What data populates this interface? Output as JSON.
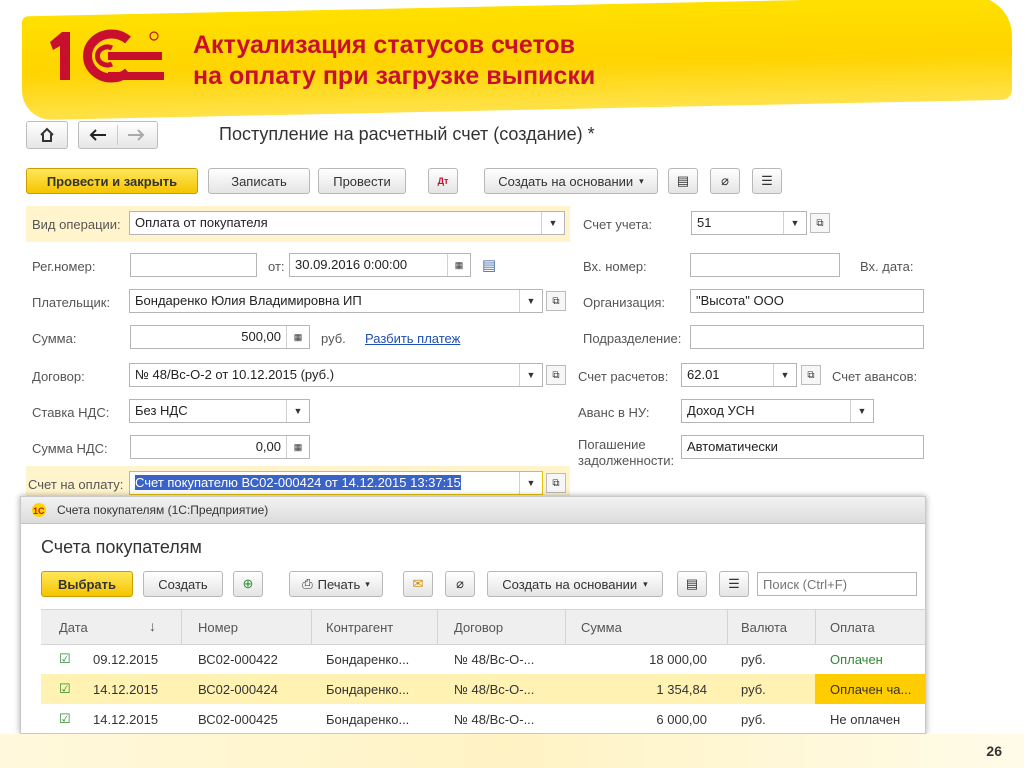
{
  "slide": {
    "title_line1": "Актуализация статусов счетов",
    "title_line2": "на оплату при загрузке выписки",
    "page_number": "26",
    "logo_text": "1С"
  },
  "form": {
    "title": "Поступление на расчетный счет (создание) *",
    "toolbar": {
      "post_close": "Провести и закрыть",
      "save": "Записать",
      "post": "Провести",
      "create_based": "Создать на основании"
    },
    "fields": {
      "op_type_label": "Вид операции:",
      "op_type_value": "Оплата от покупателя",
      "account_label": "Счет учета:",
      "account_value": "51",
      "regnum_label": "Рег.номер:",
      "regnum_value": "",
      "from_label": "от:",
      "date_value": "30.09.2016  0:00:00",
      "in_num_label": "Вх. номер:",
      "in_date_label": "Вх. дата:",
      "payer_label": "Плательщик:",
      "payer_value": "Бондаренко Юлия Владимировна ИП",
      "org_label": "Организация:",
      "org_value": "\"Высота\" ООО",
      "sum_label": "Сумма:",
      "sum_value": "500,00",
      "currency": "руб.",
      "split_link": "Разбить платеж",
      "subdiv_label": "Подразделение:",
      "contract_label": "Договор:",
      "contract_value": "№ 48/Вс-О-2 от 10.12.2015 (руб.)",
      "settle_label": "Счет расчетов:",
      "settle_value": "62.01",
      "advance_label": "Счет авансов:",
      "vat_rate_label": "Ставка НДС:",
      "vat_rate_value": "Без НДС",
      "advance_nu_label": "Аванс в НУ:",
      "advance_nu_value": "Доход УСН",
      "vat_sum_label": "Сумма НДС:",
      "vat_sum_value": "0,00",
      "debt_label_1": "Погашение",
      "debt_label_2": "задолженности:",
      "debt_value": "Автоматически",
      "invoice_label": "Счет на оплату:",
      "invoice_value": "Счет покупателю ВС02-000424 от 14.12.2015 13:37:15"
    }
  },
  "list_window": {
    "window_title": "Счета покупателям  (1С:Предприятие)",
    "heading": "Счета покупателям",
    "toolbar": {
      "select": "Выбрать",
      "create": "Создать",
      "print": "Печать",
      "create_based": "Создать на основании",
      "search_placeholder": "Поиск (Ctrl+F)"
    },
    "columns": [
      "Дата",
      "Номер",
      "Контрагент",
      "Договор",
      "Сумма",
      "Валюта",
      "Оплата"
    ],
    "rows": [
      {
        "date": "09.12.2015",
        "number": "ВС02-000422",
        "contractor": "Бондаренко...",
        "contract": "№ 48/Вс-О-...",
        "sum": "18 000,00",
        "currency": "руб.",
        "payment": "Оплачен"
      },
      {
        "date": "14.12.2015",
        "number": "ВС02-000424",
        "contractor": "Бондаренко...",
        "contract": "№ 48/Вс-О-...",
        "sum": "1 354,84",
        "currency": "руб.",
        "payment": "Оплачен ча..."
      },
      {
        "date": "14.12.2015",
        "number": "ВС02-000425",
        "contractor": "Бондаренко...",
        "contract": "№ 48/Вс-О-...",
        "sum": "6 000,00",
        "currency": "руб.",
        "payment": "Не оплачен"
      }
    ]
  },
  "colors": {
    "accent_yellow": "#ffd400",
    "title_red": "#c8102e",
    "link_blue": "#1f4fb3",
    "paid_green": "#2e8b2e",
    "selected_row": "#fff2b3",
    "selected_cell": "#ffcc00"
  }
}
